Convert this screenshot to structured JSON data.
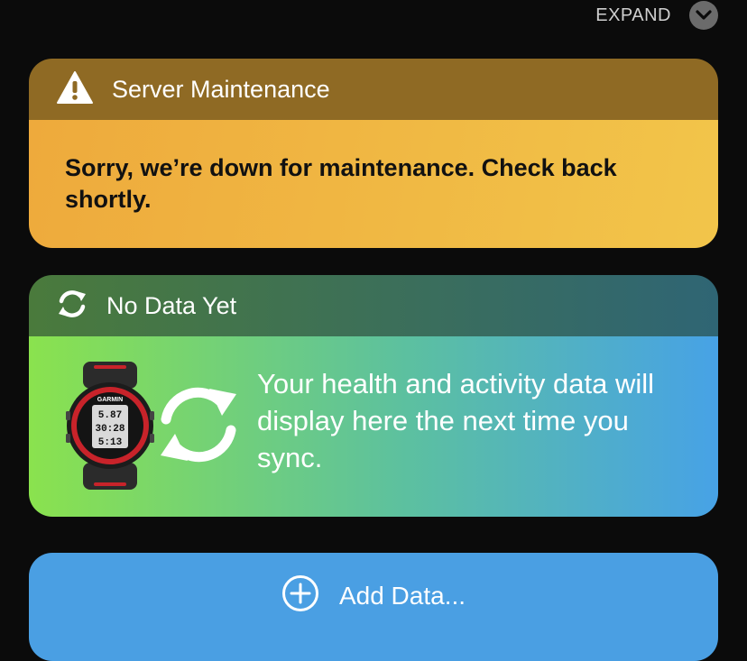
{
  "header": {
    "expand_label": "EXPAND"
  },
  "maintenance_card": {
    "title": "Server Maintenance",
    "message": "Sorry, we’re down for maintenance. Check back shortly."
  },
  "no_data_card": {
    "title": "No Data Yet",
    "message": "Your health and activity data will display here the next time you sync.",
    "watch_brand": "GARMIN",
    "watch_readouts": [
      "5.87",
      "30:28",
      "5:13"
    ]
  },
  "add_data": {
    "label": "Add Data..."
  }
}
